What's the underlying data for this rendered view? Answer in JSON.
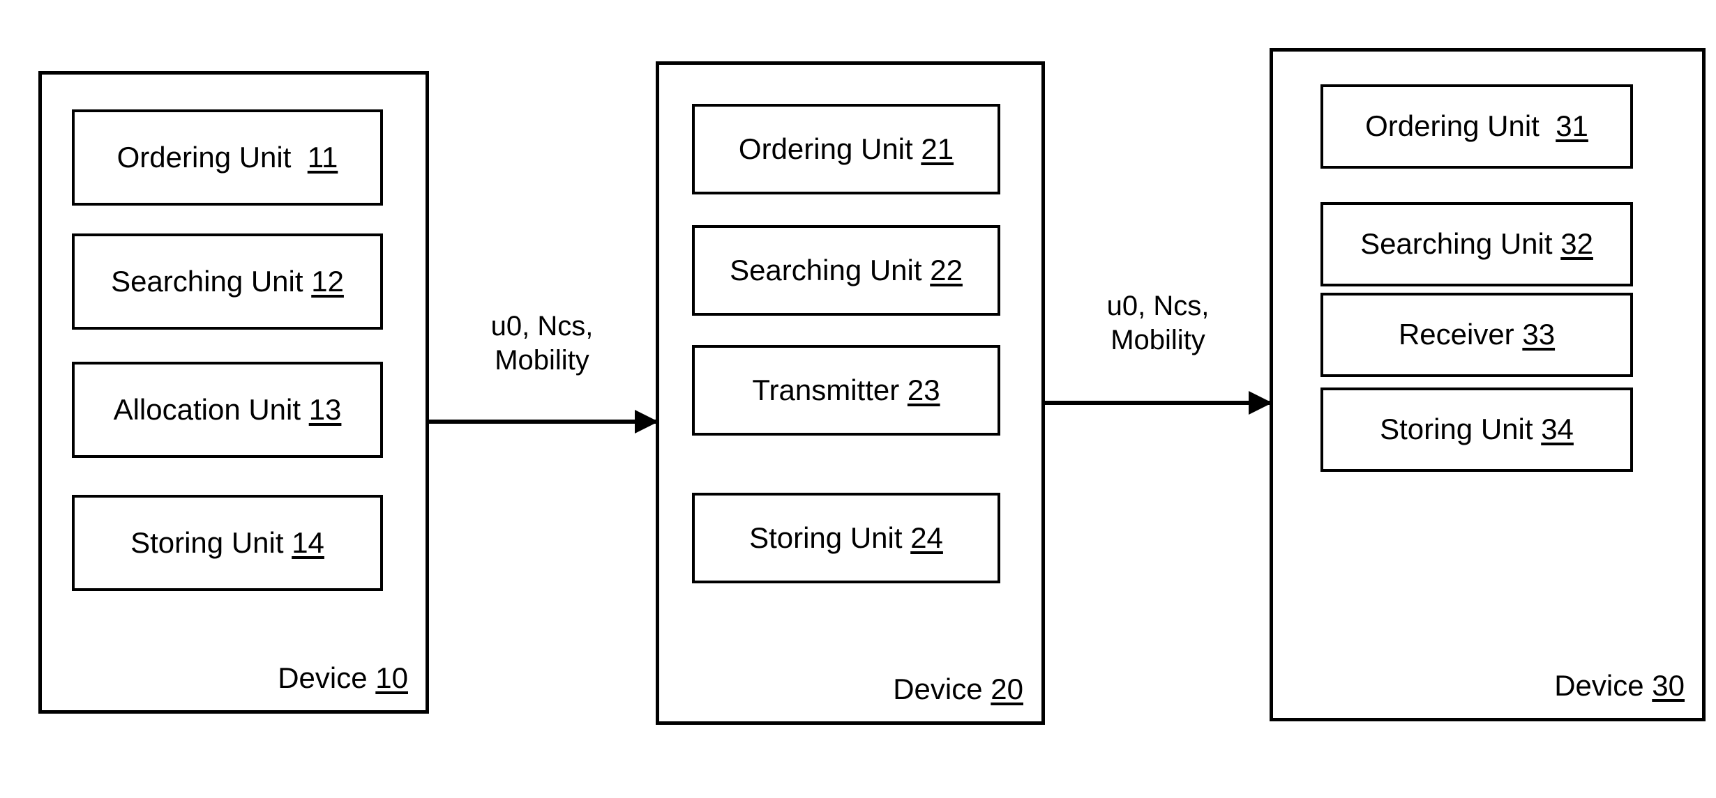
{
  "figure": {
    "type": "patent-block-diagram",
    "devices": [
      {
        "id": "device-10",
        "caption_text": "Device ",
        "caption_number": "10",
        "units": [
          {
            "text": "Ordering Unit  ",
            "number": "11"
          },
          {
            "text": "Searching Unit ",
            "number": "12"
          },
          {
            "text": "Allocation Unit ",
            "number": "13"
          },
          {
            "text": "Storing Unit ",
            "number": "14"
          }
        ]
      },
      {
        "id": "device-20",
        "caption_text": "Device ",
        "caption_number": "20",
        "units": [
          {
            "text": "Ordering Unit ",
            "number": "21"
          },
          {
            "text": "Searching Unit ",
            "number": "22"
          },
          {
            "text": "Transmitter ",
            "number": "23"
          },
          {
            "text": "Storing Unit ",
            "number": "24"
          }
        ]
      },
      {
        "id": "device-30",
        "caption_text": "Device ",
        "caption_number": "30",
        "units": [
          {
            "text": "Ordering Unit  ",
            "number": "31"
          },
          {
            "text": "Searching Unit ",
            "number": "32"
          },
          {
            "text": "Receiver ",
            "number": "33"
          },
          {
            "text": "Storing Unit ",
            "number": "34"
          }
        ]
      }
    ],
    "arrows": [
      {
        "id": "arrow-10-to-20",
        "label": "u0, Ncs,\nMobility"
      },
      {
        "id": "arrow-20-to-30",
        "label": "u0, Ncs,\nMobility"
      }
    ],
    "colors": {
      "stroke": "#000000",
      "background": "#ffffff"
    }
  }
}
